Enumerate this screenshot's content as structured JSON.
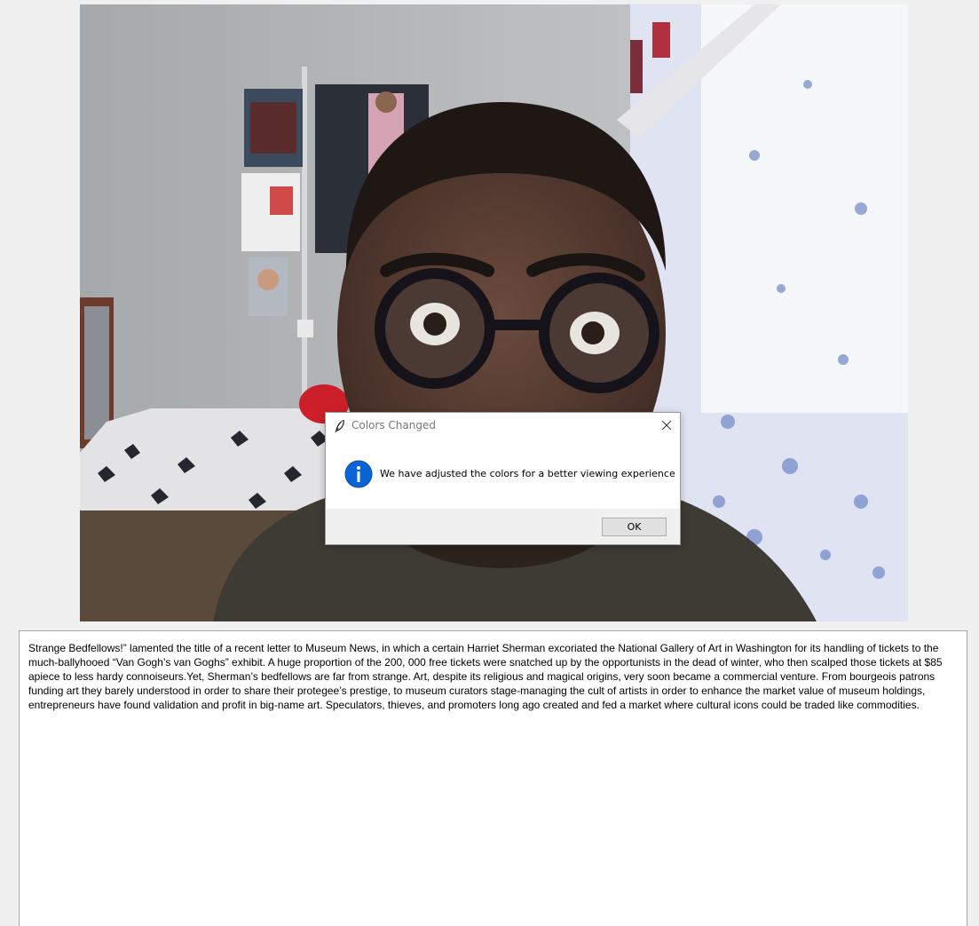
{
  "dialog": {
    "title": "Colors Changed",
    "message": "We have adjusted the colors for a better viewing experience",
    "ok_label": "OK",
    "app_icon": "feather-icon",
    "info_icon": "info-icon",
    "close_icon": "close-icon",
    "accent_color": "#0a64d6"
  },
  "text_area": {
    "content": "Strange Bedfellows!” lamented the title of a recent letter to Museum News, in which a certain Harriet Sherman excoriated the National Gallery of Art in Washington for its handling of tickets to the much-ballyhooed “Van Gogh’s van Goghs” exhibit. A huge proportion of the 200, 000 free tickets were snatched up by the opportunists in the dead of winter, who then scalped those tickets at $85 apiece to less hardy connoiseurs.Yet, Sherman’s bedfellows are far from strange. Art, despite its religious and magical origins, very soon became a commercial venture. From bourgeois patrons funding art they barely understood in order to share their protegee’s prestige, to museum curators stage-managing the cult of artists in order to enhance the market value of museum holdings, entrepreneurs have found validation and profit in big-name art. Speculators, thieves, and promoters long ago created and fed a market where cultural icons could be traded like commodities."
  }
}
